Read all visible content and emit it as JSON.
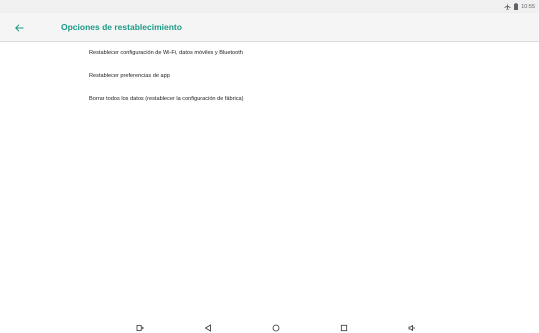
{
  "status_bar": {
    "icons": [
      "airplane-mode-icon",
      "battery-icon"
    ],
    "time": "10:55"
  },
  "app_bar": {
    "back_icon": "arrow-back-icon",
    "title": "Opciones de restablecimiento",
    "accent_color": "#1a9a85"
  },
  "options": [
    {
      "label": "Restablecer configuración de Wi-Fi, datos móviles y Bluetooth"
    },
    {
      "label": "Restablecer preferencias de app"
    },
    {
      "label": "Borrar todos los datos (restablecer la configuración de fábrica)"
    }
  ],
  "nav_bar": {
    "buttons": [
      "screenshot-icon",
      "back-triangle-icon",
      "home-circle-icon",
      "recents-square-icon",
      "volume-icon"
    ]
  }
}
